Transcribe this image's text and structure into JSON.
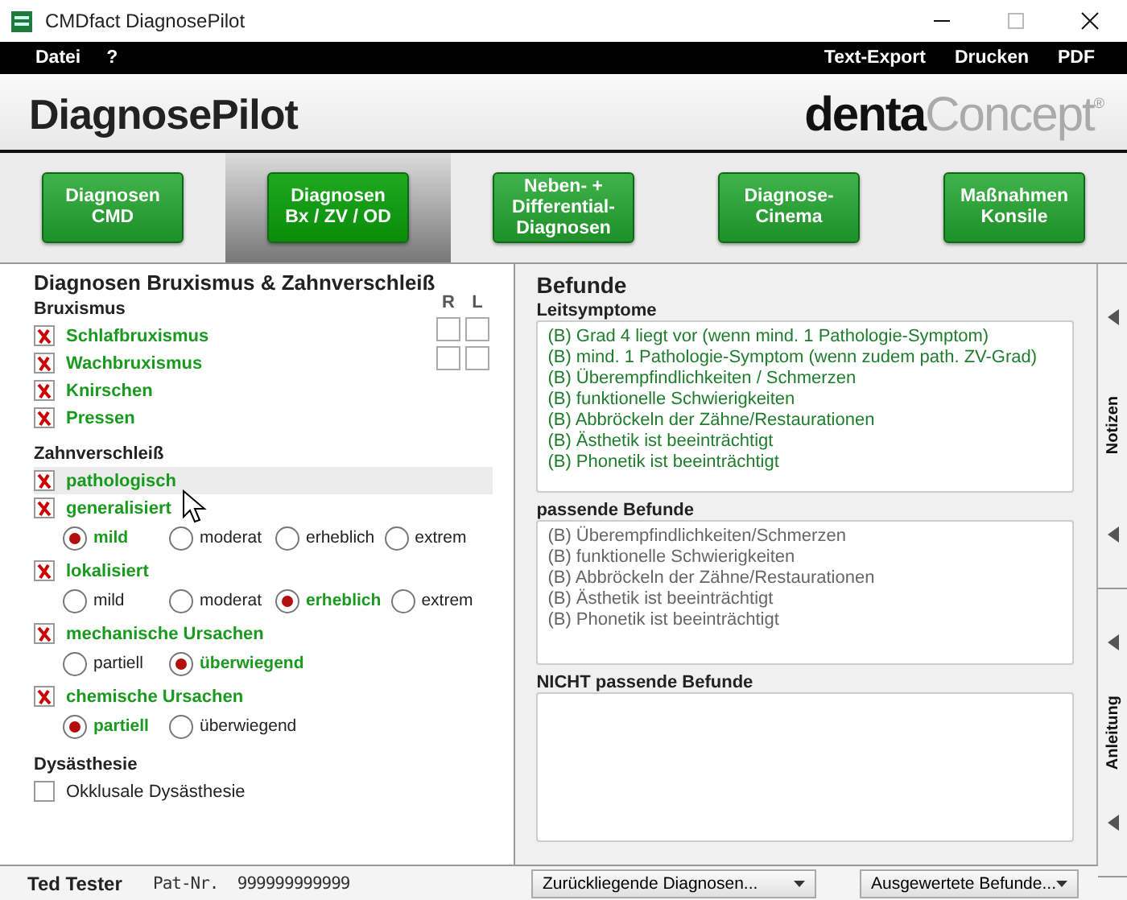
{
  "window": {
    "title": "CMDfact DiagnosePilot"
  },
  "menu": {
    "left": [
      "Datei",
      "?"
    ],
    "right": [
      "Text-Export",
      "Drucken",
      "PDF"
    ]
  },
  "header": {
    "app_name": "DiagnosePilot",
    "brand_bold": "denta",
    "brand_light": "Concept",
    "brand_mark": "®"
  },
  "nav": [
    {
      "label": "Diagnosen\nCMD",
      "selected": false
    },
    {
      "label": "Diagnosen\nBx / ZV / OD",
      "selected": true
    },
    {
      "label": "Neben- +\nDifferential-\nDiagnosen",
      "selected": false
    },
    {
      "label": "Diagnose-\nCinema",
      "selected": false
    },
    {
      "label": "Maßnahmen\nKonsile",
      "selected": false
    }
  ],
  "left": {
    "title": "Diagnosen Bruxismus & Zahnverschleiß",
    "sections": [
      {
        "heading": "Bruxismus",
        "side_grid": {
          "columns": [
            "R",
            "L"
          ],
          "rows": [
            [
              {
                "checked": false
              },
              {
                "checked": false
              }
            ],
            [
              {
                "checked": false
              },
              {
                "checked": false
              }
            ]
          ]
        },
        "items": [
          {
            "label": "Schlafbruxismus",
            "checked": true,
            "hovered": false
          },
          {
            "label": "Wachbruxismus",
            "checked": true,
            "hovered": false
          },
          {
            "label": "Knirschen",
            "checked": true,
            "hovered": false
          },
          {
            "label": "Pressen",
            "checked": true,
            "hovered": false
          }
        ]
      },
      {
        "heading": "Zahnverschleiß",
        "items": [
          {
            "label": "pathologisch",
            "checked": true,
            "hovered": true
          },
          {
            "label": "generalisiert",
            "checked": true,
            "hovered": false,
            "options": [
              {
                "label": "mild",
                "selected": true
              },
              {
                "label": "moderat",
                "selected": false
              },
              {
                "label": "erheblich",
                "selected": false
              },
              {
                "label": "extrem",
                "selected": false
              }
            ]
          },
          {
            "label": "lokalisiert",
            "checked": true,
            "hovered": false,
            "options": [
              {
                "label": "mild",
                "selected": false
              },
              {
                "label": "moderat",
                "selected": false
              },
              {
                "label": "erheblich",
                "selected": true
              },
              {
                "label": "extrem",
                "selected": false
              }
            ]
          },
          {
            "label": "mechanische Ursachen",
            "checked": true,
            "hovered": false,
            "options": [
              {
                "label": "partiell",
                "selected": false
              },
              {
                "label": "überwiegend",
                "selected": true
              }
            ]
          },
          {
            "label": "chemische Ursachen",
            "checked": true,
            "hovered": false,
            "options": [
              {
                "label": "partiell",
                "selected": true
              },
              {
                "label": "überwiegend",
                "selected": false
              }
            ]
          }
        ]
      },
      {
        "heading": "Dysästhesie",
        "items": [
          {
            "label": "Okklusale Dysästhesie",
            "checked": false,
            "hovered": false
          }
        ]
      }
    ]
  },
  "right": {
    "title": "Befunde",
    "lists": [
      {
        "heading": "Leitsymptome",
        "kind": "lead",
        "items": [
          "(B) Grad 4 liegt vor (wenn mind. 1 Pathologie-Symptom)",
          "(B) mind. 1 Pathologie-Symptom (wenn zudem path. ZV-Grad)",
          "(B) Überempfindlichkeiten / Schmerzen",
          "(B) funktionelle Schwierigkeiten",
          "(B) Abbröckeln der Zähne/Restaurationen",
          "(B) Ästhetik ist beeinträchtigt",
          "(B) Phonetik ist beeinträchtigt"
        ]
      },
      {
        "heading": "passende Befunde",
        "kind": "match",
        "items": [
          "(B) Überempfindlichkeiten/Schmerzen",
          "(B) funktionelle Schwierigkeiten",
          "(B) Abbröckeln der Zähne/Restaurationen",
          "(B) Ästhetik ist beeinträchtigt",
          "(B) Phonetik ist beeinträchtigt"
        ]
      },
      {
        "heading": "NICHT passende Befunde",
        "kind": "nomatch"
      }
    ]
  },
  "side_tabs": [
    "Notizen",
    "Anleitung"
  ],
  "footer": {
    "patient": "Ted Tester",
    "patient_no": "Pat-Nr.  999999999999",
    "dropdowns": [
      "Zurückliegende Diagnosen...",
      "Ausgewertete Befunde..."
    ]
  }
}
